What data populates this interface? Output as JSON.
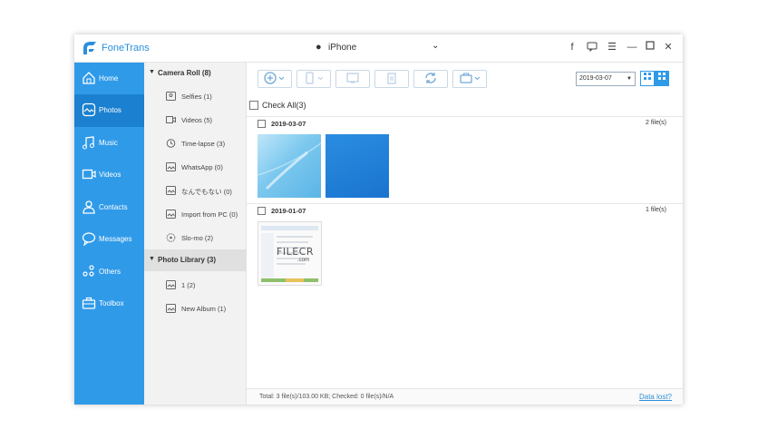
{
  "app": {
    "title": "FoneTrans"
  },
  "device": {
    "name": "iPhone"
  },
  "sidebar": {
    "items": [
      {
        "label": "Home",
        "icon": "home-icon"
      },
      {
        "label": "Photos",
        "icon": "photos-icon"
      },
      {
        "label": "Music",
        "icon": "music-icon"
      },
      {
        "label": "Videos",
        "icon": "videos-icon"
      },
      {
        "label": "Contacts",
        "icon": "contacts-icon"
      },
      {
        "label": "Messages",
        "icon": "messages-icon"
      },
      {
        "label": "Others",
        "icon": "others-icon"
      },
      {
        "label": "Toolbox",
        "icon": "toolbox-icon"
      }
    ],
    "active": "Photos"
  },
  "albums": {
    "camera_roll": "Camera Roll (8)",
    "camera_items": [
      "Selfies (1)",
      "Videos (5)",
      "Time-lapse (3)",
      "WhatsApp (0)",
      "なんでもない (0)",
      "Import from PC (0)",
      "Slo-mo (2)"
    ],
    "photo_library": "Photo Library (3)",
    "library_items": [
      "1 (2)",
      "New Album (1)"
    ]
  },
  "toolbar": {
    "date_value": "2019-03-07"
  },
  "content": {
    "check_all": "Check All(3)",
    "groups": [
      {
        "date": "2019-03-07",
        "count": "2 file(s)"
      },
      {
        "date": "2019-01-07",
        "count": "1 file(s)"
      }
    ],
    "watermark": "FILECR",
    "watermark_sub": ".com"
  },
  "footer": {
    "total": "Total: 3 file(s)/103.00 KB; Checked: 0 file(s)/N/A",
    "data_lost": "Data lost?"
  },
  "colors": {
    "accent": "#2f9ae8",
    "sidebar_active": "#1a80cf"
  }
}
